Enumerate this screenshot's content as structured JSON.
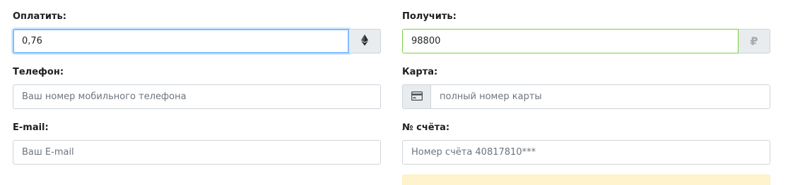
{
  "pay": {
    "label": "Оплатить:",
    "value": "0,76",
    "currency_icon": "ethereum-icon"
  },
  "receive": {
    "label": "Получить:",
    "value": "98800",
    "currency_icon": "ruble-icon",
    "currency_symbol": "₽"
  },
  "phone": {
    "label": "Телефон:",
    "placeholder": "Ваш номер мобильного телефона"
  },
  "card": {
    "label": "Карта:",
    "placeholder": "полный номер карты",
    "icon": "credit-card-icon"
  },
  "email": {
    "label": "E-mail:",
    "placeholder": "Ваш E-mail"
  },
  "account": {
    "label": "№ счёта:",
    "placeholder": "Номер счёта  40817810***"
  },
  "colors": {
    "focus_border": "#80bdff",
    "valid_border": "#7bd03b",
    "addon_bg": "#e9ecef",
    "alert_bg": "#fff3cd"
  }
}
